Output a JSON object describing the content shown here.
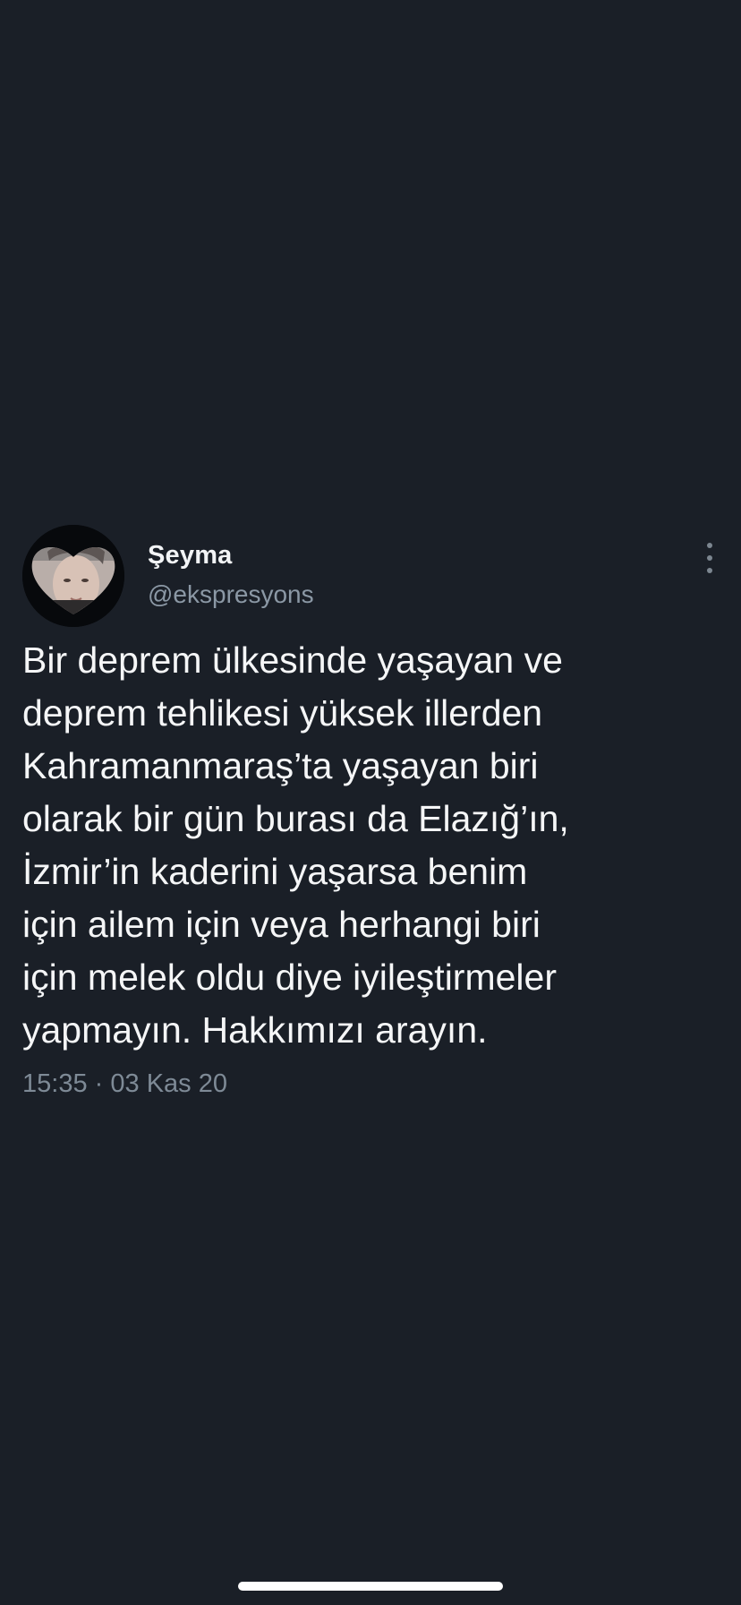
{
  "tweet": {
    "author": {
      "name": "Şeyma",
      "handle": "@ekspresyons"
    },
    "text_lines": [
      "Bir deprem ülkesinde yaşayan ve",
      "deprem tehlikesi yüksek illerden",
      "Kahramanmaraş’ta yaşayan biri",
      "olarak bir gün burası da Elazığ’ın,",
      "İzmir’in kaderini yaşarsa benim",
      "için ailem için veya herhangi biri",
      "için melek oldu diye iyileştirmeler",
      "yapmayın. Hakkımızı arayın."
    ],
    "time": "15:35",
    "separator": "·",
    "date": "03 Kas 20"
  },
  "icons": {
    "more": "more-vertical-icon"
  },
  "colors": {
    "background": "#1a1f27",
    "text": "#f5f6f7",
    "muted": "#8b98a5"
  }
}
